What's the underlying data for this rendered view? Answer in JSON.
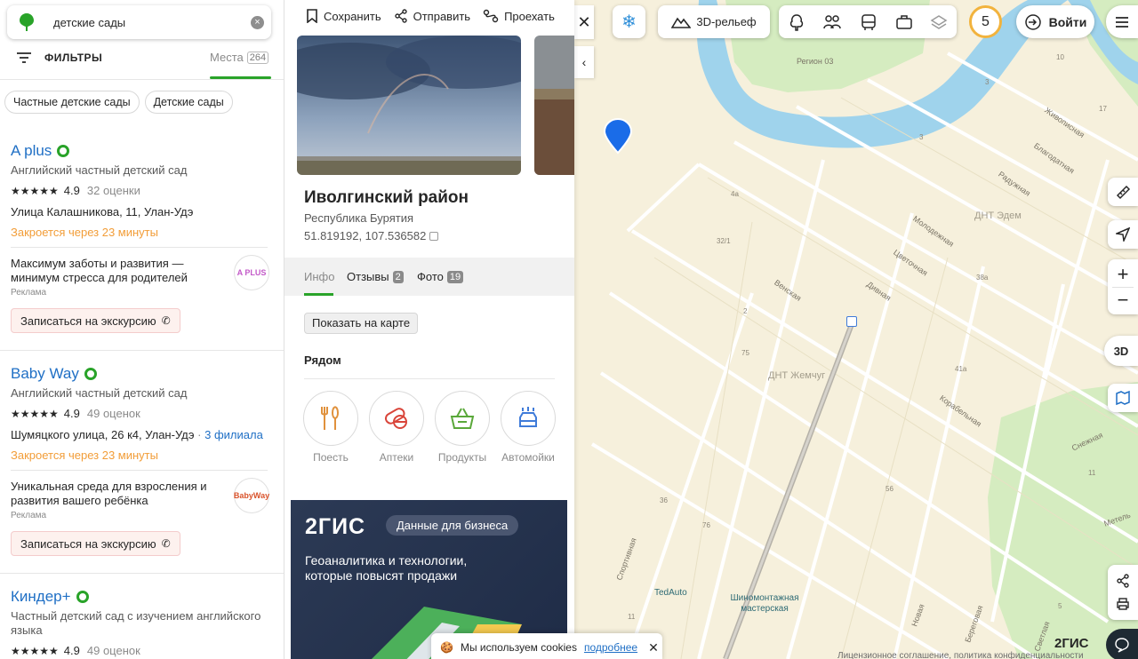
{
  "search": {
    "value": "детские сады"
  },
  "filters": {
    "label": "ФИЛЬТРЫ",
    "places_label": "Места",
    "places_count": "264"
  },
  "chips": [
    "Частные детские сады",
    "Детские сады"
  ],
  "cards": [
    {
      "name": "A plus",
      "desc": "Английский частный детский сад",
      "stars": "★★★★★",
      "score": "4.9",
      "reviews": "32 оценки",
      "addr": "Улица Калашникова, 11, Улан-Удэ",
      "branches": "",
      "closing": "Закроется через 23 минуты",
      "ad_text": "Максимум заботы и развития — минимум стресса для родителей",
      "ad_mark": "Реклама",
      "ad_logo": "A PLUS",
      "excursion": "Записаться на экскурсию"
    },
    {
      "name": "Baby Way",
      "desc": "Английский частный детский сад",
      "stars": "★★★★★",
      "score": "4.9",
      "reviews": "49 оценок",
      "addr": "Шумяцкого улица, 26 к4, Улан-Удэ",
      "branches": "3 филиала",
      "closing": "Закроется через 23 минуты",
      "ad_text": "Уникальная среда для взросления и развития вашего ребёнка",
      "ad_mark": "Реклама",
      "ad_logo": "BabyWay",
      "excursion": "Записаться на экскурсию"
    },
    {
      "name": "Киндер+",
      "desc": "Частный детский сад с изучением английского языка",
      "stars": "★★★★★",
      "score": "4.9",
      "reviews": "49 оценок"
    }
  ],
  "detail": {
    "actions": [
      "Сохранить",
      "Отправить",
      "Проехать"
    ],
    "title": "Иволгинский район",
    "subtitle": "Республика Бурятия",
    "coords": "51.819192, 107.536582",
    "tabs": [
      {
        "label": "Инфо",
        "count": ""
      },
      {
        "label": "Отзывы",
        "count": "2"
      },
      {
        "label": "Фото",
        "count": "19"
      }
    ],
    "show_on_map": "Показать на карте",
    "nearby_title": "Рядом",
    "nearby": [
      "Поесть",
      "Аптеки",
      "Продукты",
      "Автомойки"
    ],
    "banner": {
      "brand": "2ГИС",
      "pill": "Данные для бизнеса",
      "text": "Геоаналитика и технологии, которые повысят продажи"
    }
  },
  "cookie": {
    "text": "Мы используем cookies",
    "more": "подробнее"
  },
  "map": {
    "relief_label": "3D-рельеф",
    "level_badge": "5",
    "login_label": "Войти",
    "btn_3d": "3D",
    "logo": "2ГИС",
    "footer": "Лицензионное соглашение, политика конфиденциальности",
    "watermark": "2GIS",
    "labels": {
      "region": "Регион 03",
      "dnt_edem": "ДНТ Эдем",
      "dnt_zhemch": "ДНТ Жемчуг",
      "zhivopisnaya": "Живописная",
      "blagodatnaya": "Благодатная",
      "raduzhnaya": "Радужная",
      "molodezhnaya": "Молодежная",
      "tsvetochnaya": "Цветочная",
      "divnaya": "Дивная",
      "venskaya": "Венская",
      "korabelnaya": "Корабельная",
      "snezhnaya": "Снежная",
      "sportivnaya": "Спортивная",
      "novaya": "Новая",
      "beregovaya": "Береговая",
      "svetlaya": "Светлая",
      "metelnaya": "Метель",
      "tedauto": "TedAuto",
      "tire_shop": "Шиномонтажная мастерская"
    },
    "numbers": [
      "10",
      "3",
      "17",
      "3",
      "4а",
      "32/1",
      "38а",
      "2",
      "75",
      "41а",
      "36",
      "76",
      "56",
      "11",
      "5",
      "11"
    ]
  }
}
